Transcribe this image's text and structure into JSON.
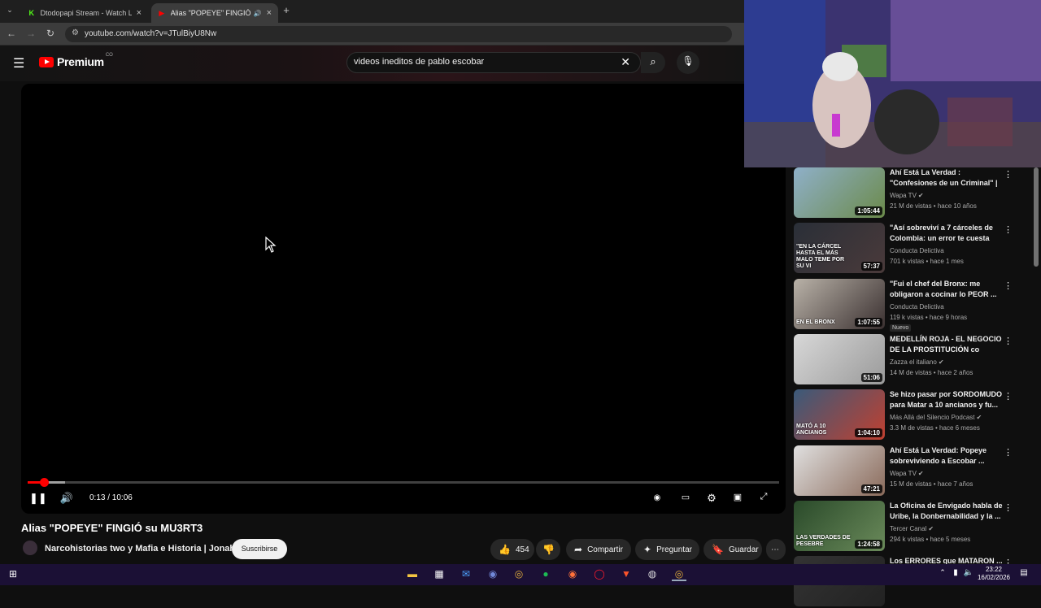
{
  "browser": {
    "tabs": [
      {
        "title": "Dtodopapi Stream - Watch Live",
        "favicon": "kick-icon",
        "active": false
      },
      {
        "title": "Alias \"POPEYE\" FINGIÓ su M",
        "favicon": "youtube-icon",
        "active": true
      }
    ],
    "url": "youtube.com/watch?v=JTulBiyU8Nw"
  },
  "youtube": {
    "logo_text": "Premium",
    "logo_badge": "CO",
    "search_query": "videos ineditos de pablo escobar"
  },
  "player": {
    "time_display": "0:13 / 10:06",
    "progress_fraction": 0.0215,
    "buffer_fraction": 0.05,
    "state": "playing"
  },
  "video": {
    "title": "Alias \"POPEYE\" FINGIÓ su MU3RT3",
    "channel": "Narcohistorias two y Mafia e Historia | Jonah",
    "subscribe_label": "Suscribirse",
    "likes": "454",
    "share_label": "Compartir",
    "ask_label": "Preguntar",
    "save_label": "Guardar"
  },
  "recommendations": [
    {
      "title": "Ahí Está La Verdad : \"Confesiones de un Criminal\" | ...",
      "channel": "Wapa TV",
      "verified": true,
      "meta": "21 M de vistas • hace 10 años",
      "duration": "1:05:44",
      "badge": "",
      "colors": [
        "#8fb0c9",
        "#6b8a4a"
      ]
    },
    {
      "title": "\"Así sobreviví a 7 cárceles de Colombia: un error te cuesta la...",
      "channel": "Conducta Delictiva",
      "verified": false,
      "meta": "701 k vistas • hace 1 mes",
      "duration": "57:37",
      "badge": "",
      "overlay": "\"EN LA CÁRCEL HASTA EL MÁS MALO TEME POR SU VI",
      "colors": [
        "#2a2f38",
        "#4a3a3a"
      ]
    },
    {
      "title": "\"Fui el chef del Bronx: me obligaron a cocinar lo PEOR ...",
      "channel": "Conducta Delictiva",
      "verified": false,
      "meta": "119 k vistas • hace 9 horas",
      "duration": "1:07:55",
      "badge": "Nuevo",
      "overlay": "EN EL BRONX",
      "colors": [
        "#b9b2a8",
        "#3a3030"
      ]
    },
    {
      "title": "MEDELLÍN ROJA - EL NEGOCIO DE LA PROSTITUCIÓN co",
      "channel": "Zazza el italiano",
      "verified": true,
      "meta": "14 M de vistas • hace 2 años",
      "duration": "51:06",
      "badge": "",
      "colors": [
        "#d8d8d8",
        "#9a9a9a"
      ]
    },
    {
      "title": "Se hizo pasar por SORDOMUDO para Matar a 10 ancianos y fu...",
      "channel": "Más Allá del Silencio Podcast",
      "verified": true,
      "meta": "3.3 M de vistas • hace 6 meses",
      "duration": "1:04:10",
      "badge": "",
      "overlay": "MATÓ A 10 ANCIANOS",
      "colors": [
        "#3a5a7a",
        "#c04030"
      ]
    },
    {
      "title": "Ahí Está La Verdad: Popeye sobreviviendo a Escobar ...",
      "channel": "Wapa TV",
      "verified": true,
      "meta": "15 M de vistas • hace 7 años",
      "duration": "47:21",
      "badge": "",
      "colors": [
        "#e0e0e0",
        "#8a6a5a"
      ]
    },
    {
      "title": "La Oficina de Envigado habla de Uribe, la Donbernabilidad y la ...",
      "channel": "Tercer Canal",
      "verified": true,
      "meta": "294 k vistas • hace 5 meses",
      "duration": "1:24:58",
      "badge": "",
      "overlay": "LAS VERDADES DE PESEBRE",
      "colors": [
        "#2a4a2a",
        "#6a8a5a"
      ]
    },
    {
      "title": "Los ERRORES que MATARON ...",
      "channel": "",
      "verified": false,
      "meta": "",
      "duration": "",
      "badge": "",
      "colors": [
        "#333333",
        "#222222"
      ]
    }
  ],
  "taskbar": {
    "clock_time": "23:22",
    "clock_date": "16/02/2026"
  }
}
